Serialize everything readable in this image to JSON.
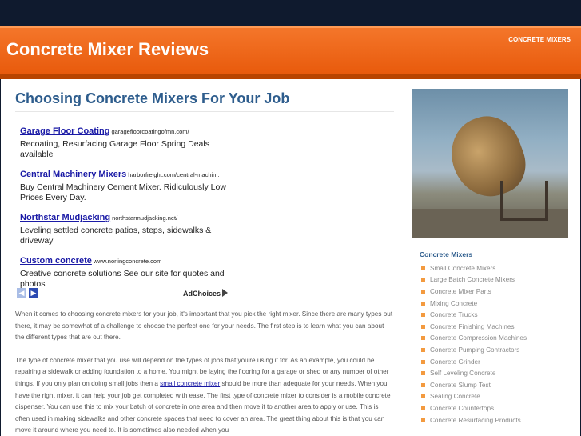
{
  "header": {
    "site_title": "Concrete Mixer Reviews",
    "nav_link": "CONCRETE MIXERS"
  },
  "main": {
    "title": "Choosing Concrete Mixers For Your Job",
    "ads": [
      {
        "title": "Garage Floor Coating",
        "url": "garagefloorcoatingofmn.com/",
        "desc": "Recoating, Resurfacing Garage Floor Spring Deals available"
      },
      {
        "title": "Central Machinery Mixers",
        "url": "harborfreight.com/central-machin..",
        "desc": "Buy Central Machinery Cement Mixer. Ridiculously Low Prices Every Day."
      },
      {
        "title": "Northstar Mudjacking",
        "url": "northstarmudjacking.net/",
        "desc": "Leveling settled concrete patios, steps, sidewalks & driveway"
      },
      {
        "title": "Custom concrete",
        "url": "www.norlingconcrete.com",
        "desc": "Creative concrete solutions See our site for quotes and photos"
      }
    ],
    "ad_nav": {
      "prev_icon": "chevron-left-icon",
      "next_icon": "chevron-right-icon",
      "adchoices": "AdChoices"
    },
    "paragraph1": "When it comes to choosing concrete mixers for your job, it's important that you pick the right mixer. Since there are many types out there, it may be somewhat of a challenge to choose the perfect one for your needs. The first step is to learn what you can about the different types that are out there.",
    "paragraph2_before": "The type of concrete mixer that you use will depend on the types of jobs that you're using it for. As an example, you could be repairing a sidewalk or adding foundation to a home. You might be laying the flooring for a garage or shed or any number of other things. If you only plan on doing small jobs then a ",
    "paragraph2_link": "small concrete mixer",
    "paragraph2_after": " should be more than adequate for your needs. When you have the right mixer, it can help your job get completed with ease. The first type of concrete mixer to consider is a mobile concrete dispenser. You can use this to mix your batch of concrete in one area and then move it to another area to apply or use. This is often used in making sidewalks and other concrete spaces that need to cover an area. The great thing about this is that you can move it around where you need to. It is sometimes also needed when you"
  },
  "sidebar": {
    "title": "Concrete Mixers",
    "items": [
      "Small Concrete Mixers",
      "Large Batch Concrete Mixers",
      "Concrete Mixer Parts",
      "Mixing Concrete",
      "Concrete Trucks",
      "Concrete Finishing Machines",
      "Concrete Compression Machines",
      "Concrete Pumping Contractors",
      "Concrete Grinder",
      "Self Leveling Concrete",
      "Concrete Slump Test",
      "Sealing Concrete",
      "Concrete Countertops",
      "Concrete Resurfacing Products"
    ]
  },
  "colors": {
    "header_orange": "#e85a0c",
    "title_blue": "#2e5d8d",
    "link_blue": "#1a1aa6",
    "bullet_orange": "#f39a3f"
  }
}
